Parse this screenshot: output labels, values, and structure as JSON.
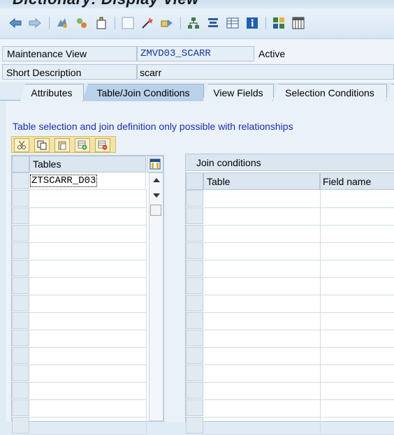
{
  "window": {
    "title": "Dictionary: Display View"
  },
  "toolbar": {
    "icons": [
      "back-arrow-icon",
      "forward-arrow-icon",
      "other-object-icon",
      "display-change-icon",
      "activate-icon",
      "blank-icon",
      "where-used-icon",
      "navigate-icon",
      "hierarchy-icon",
      "align-icon",
      "table-icon",
      "info-icon",
      "structure-icon",
      "columns-icon"
    ]
  },
  "header": {
    "maintenance_view_label": "Maintenance View",
    "maintenance_view_value": "ZMVD03_SCARR",
    "status": "Active",
    "short_desc_label": "Short Description",
    "short_desc_value": "scarr"
  },
  "tabs": [
    {
      "label": "Attributes",
      "active": false
    },
    {
      "label": "Table/Join Conditions",
      "active": true
    },
    {
      "label": "View Fields",
      "active": false
    },
    {
      "label": "Selection Conditions",
      "active": false
    }
  ],
  "message": "Table selection and join definition only possible with relationships",
  "mini_toolbar": {
    "icons": [
      "cut-icon",
      "copy-icon",
      "paste-icon",
      "insert-row-icon",
      "delete-row-icon"
    ]
  },
  "tables_grid": {
    "header": "Tables",
    "rows": [
      "ZTSCARR_D03"
    ]
  },
  "join_grid": {
    "title": "Join conditions",
    "columns": [
      "Table",
      "Field name"
    ]
  },
  "colors": {
    "accent_blue": "#1a2fb0",
    "tab_active": "#b9d2ea",
    "grid_header": "#dbe6f0"
  }
}
